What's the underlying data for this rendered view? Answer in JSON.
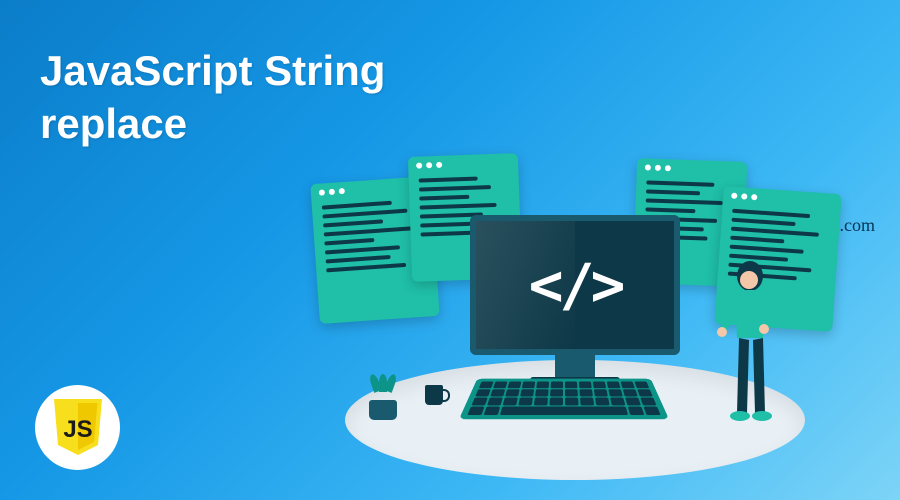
{
  "title_line1": "JavaScript String",
  "title_line2": "replace",
  "website_url": "www.educba.com",
  "logo_text": "JS",
  "monitor_symbol": "</>",
  "colors": {
    "background_gradient_start": "#0b7dc9",
    "background_gradient_end": "#7dd4f7",
    "teal_accent": "#1fbfa8",
    "dark_navy": "#0d3847",
    "js_yellow": "#f7df1e"
  }
}
